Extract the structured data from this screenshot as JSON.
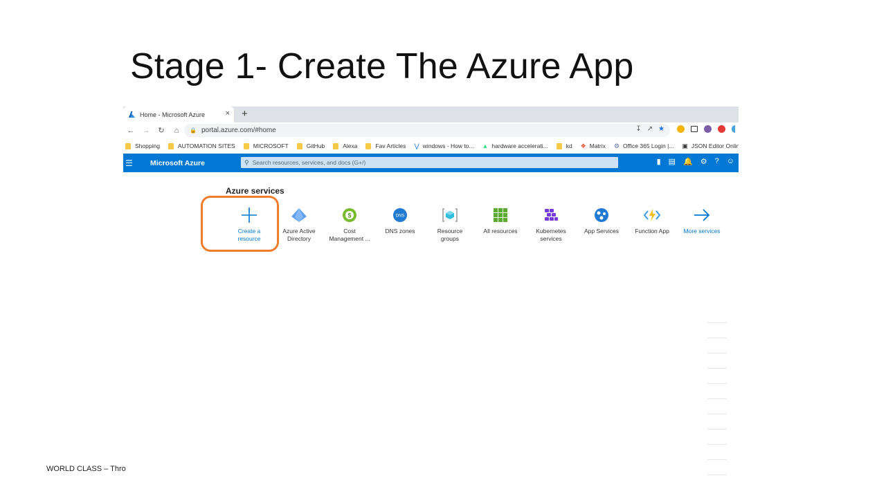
{
  "slide": {
    "title": "Stage 1- Create The Azure App",
    "footer": "WORLD CLASS  –  Thro"
  },
  "browser": {
    "tab_title": "Home - Microsoft Azure",
    "tab_close": "×",
    "new_tab": "+",
    "url": "portal.azure.com/#home",
    "bookmarks": [
      {
        "label": "Shopping",
        "icon": "folder-icon"
      },
      {
        "label": "AUTOMATION SITES",
        "icon": "folder-icon"
      },
      {
        "label": "MICROSOFT",
        "icon": "folder-icon"
      },
      {
        "label": "GitHub",
        "icon": "folder-icon"
      },
      {
        "label": "Alexa",
        "icon": "folder-icon"
      },
      {
        "label": "Fav Articles",
        "icon": "folder-icon"
      },
      {
        "label": "windows - How to...",
        "icon": "page-icon"
      },
      {
        "label": "hardware accelerati...",
        "icon": "android-icon"
      },
      {
        "label": "kd",
        "icon": "folder-icon"
      },
      {
        "label": "Matrix",
        "icon": "matrix-icon"
      },
      {
        "label": "Office 365 Login |...",
        "icon": "gear-icon"
      },
      {
        "label": "JSON Editor Online",
        "icon": "json-icon"
      }
    ]
  },
  "azure": {
    "brand": "Microsoft Azure",
    "search_placeholder": "Search resources, services, and docs (G+/)",
    "services_title": "Azure services",
    "services": [
      {
        "line1": "Create a",
        "line2": "resource",
        "icon": "plus-icon"
      },
      {
        "line1": "Azure Active",
        "line2": "Directory",
        "icon": "aad-icon"
      },
      {
        "line1": "Cost",
        "line2": "Management ...",
        "icon": "cost-icon"
      },
      {
        "line1": "DNS zones",
        "line2": "",
        "icon": "dns-icon"
      },
      {
        "line1": "Resource",
        "line2": "groups",
        "icon": "resource-groups-icon"
      },
      {
        "line1": "All resources",
        "line2": "",
        "icon": "grid-icon"
      },
      {
        "line1": "Kubernetes",
        "line2": "services",
        "icon": "kubernetes-icon"
      },
      {
        "line1": "App Services",
        "line2": "",
        "icon": "globe-icon"
      },
      {
        "line1": "Function App",
        "line2": "",
        "icon": "bolt-icon"
      },
      {
        "line1": "More services",
        "line2": "",
        "icon": "arrow-right-icon"
      }
    ]
  },
  "colors": {
    "azure_blue": "#0078d4",
    "highlight_orange": "#f07d2b",
    "folder_yellow": "#f7c948"
  }
}
